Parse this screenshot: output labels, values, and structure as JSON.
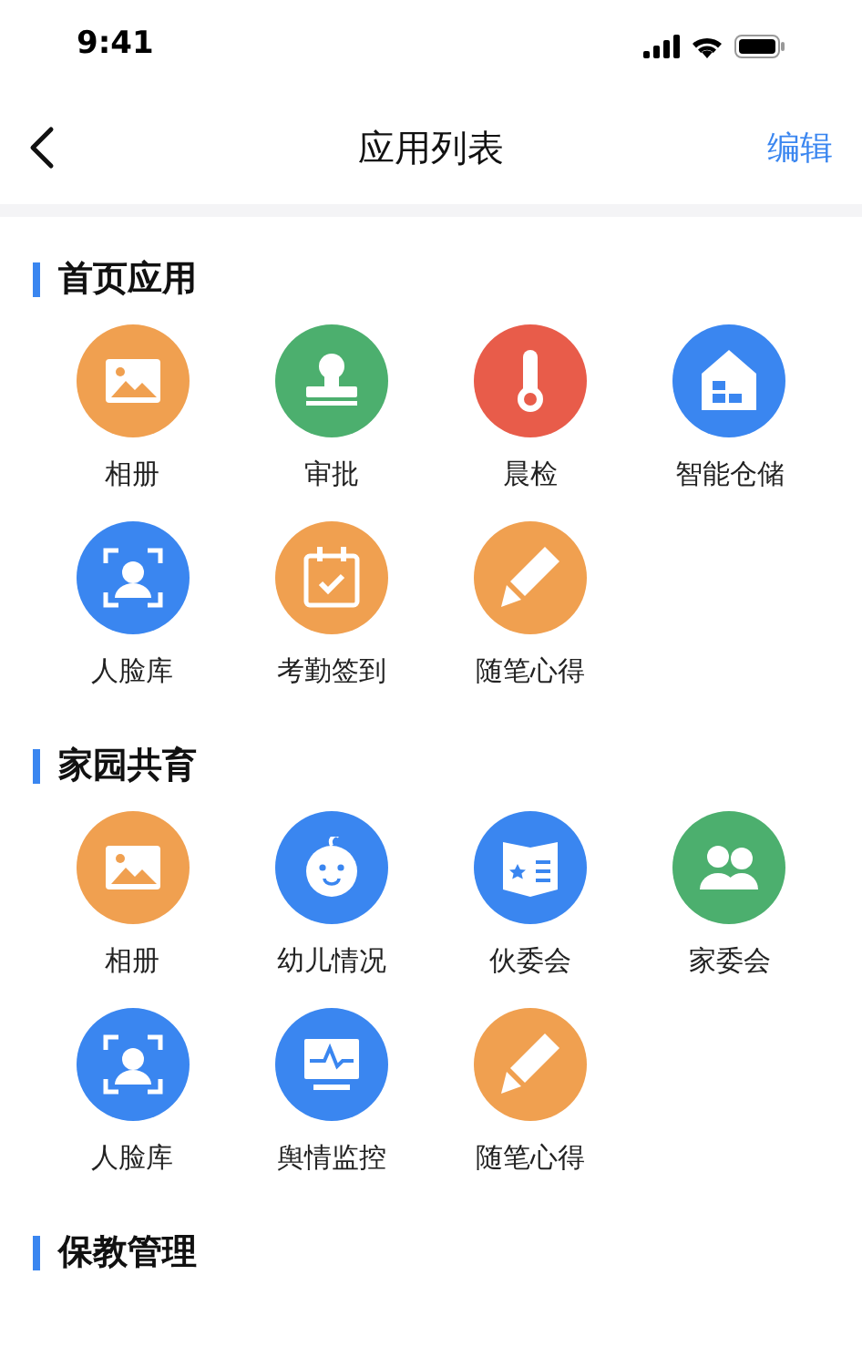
{
  "status_bar": {
    "time": "9:41"
  },
  "nav": {
    "title": "应用列表",
    "action": "编辑"
  },
  "sections": [
    {
      "title": "首页应用",
      "apps": [
        {
          "label": "相册",
          "kind": "album",
          "color": "#f0a050"
        },
        {
          "label": "审批",
          "kind": "stamp",
          "color": "#4caf6e"
        },
        {
          "label": "晨检",
          "kind": "thermometer",
          "color": "#e85c4a"
        },
        {
          "label": "智能仓储",
          "kind": "warehouse",
          "color": "#3a86f0"
        },
        {
          "label": "人脸库",
          "kind": "face",
          "color": "#3a86f0"
        },
        {
          "label": "考勤签到",
          "kind": "calendar",
          "color": "#f0a050"
        },
        {
          "label": "随笔心得",
          "kind": "pencil",
          "color": "#f0a050"
        }
      ]
    },
    {
      "title": "家园共育",
      "apps": [
        {
          "label": "相册",
          "kind": "album",
          "color": "#f0a050"
        },
        {
          "label": "幼儿情况",
          "kind": "baby",
          "color": "#3a86f0"
        },
        {
          "label": "伙委会",
          "kind": "book",
          "color": "#3a86f0"
        },
        {
          "label": "家委会",
          "kind": "parents",
          "color": "#4caf6e"
        },
        {
          "label": "人脸库",
          "kind": "face",
          "color": "#3a86f0"
        },
        {
          "label": "舆情监控",
          "kind": "monitor",
          "color": "#3a86f0"
        },
        {
          "label": "随笔心得",
          "kind": "pencil",
          "color": "#f0a050"
        }
      ]
    },
    {
      "title": "保教管理"
    }
  ]
}
